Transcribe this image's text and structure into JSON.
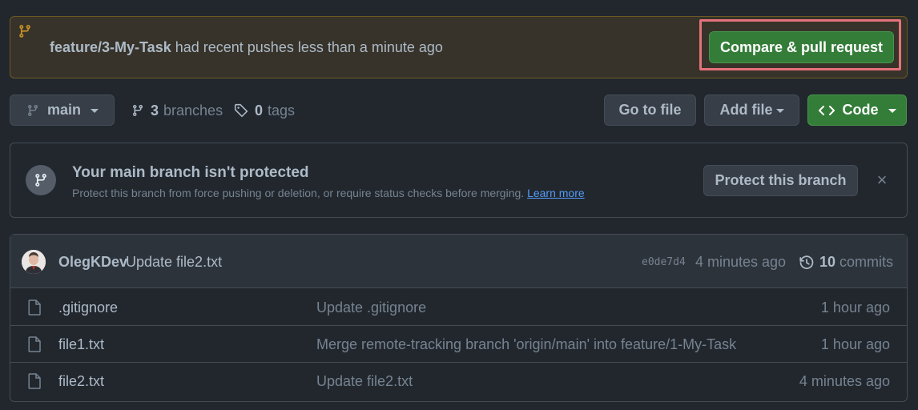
{
  "push_banner": {
    "branch": "feature/3-My-Task",
    "message": " had recent pushes less than a minute ago",
    "compare_button": "Compare & pull request"
  },
  "toolbar": {
    "branch_name": "main",
    "branches_count": "3",
    "branches_label": "branches",
    "tags_count": "0",
    "tags_label": "tags",
    "goto_file": "Go to file",
    "add_file": "Add file",
    "code": "Code"
  },
  "protect": {
    "title": "Your main branch isn't protected",
    "description": "Protect this branch from force pushing or deletion, or require status checks before merging.",
    "learn_more": "Learn more",
    "button": "Protect this branch",
    "close": "×"
  },
  "latest_commit": {
    "author": "OlegKDev",
    "message": "Update file2.txt",
    "sha": "e0de7d4",
    "time": "4 minutes ago",
    "commits_count": "10",
    "commits_label": "commits"
  },
  "files": [
    {
      "name": ".gitignore",
      "commit": "Update .gitignore",
      "age": "1 hour ago"
    },
    {
      "name": "file1.txt",
      "commit": "Merge remote-tracking branch 'origin/main' into feature/1-My-Task",
      "age": "1 hour ago"
    },
    {
      "name": "file2.txt",
      "commit": "Update file2.txt",
      "age": "4 minutes ago"
    }
  ],
  "colors": {
    "background": "#22272e",
    "banner_bg": "#37332a",
    "banner_border": "#6b5a24",
    "accent_green": "#347d39",
    "highlight_red": "#e5727b",
    "link_blue": "#539bf5",
    "branch_icon_yellow": "#c69026"
  }
}
